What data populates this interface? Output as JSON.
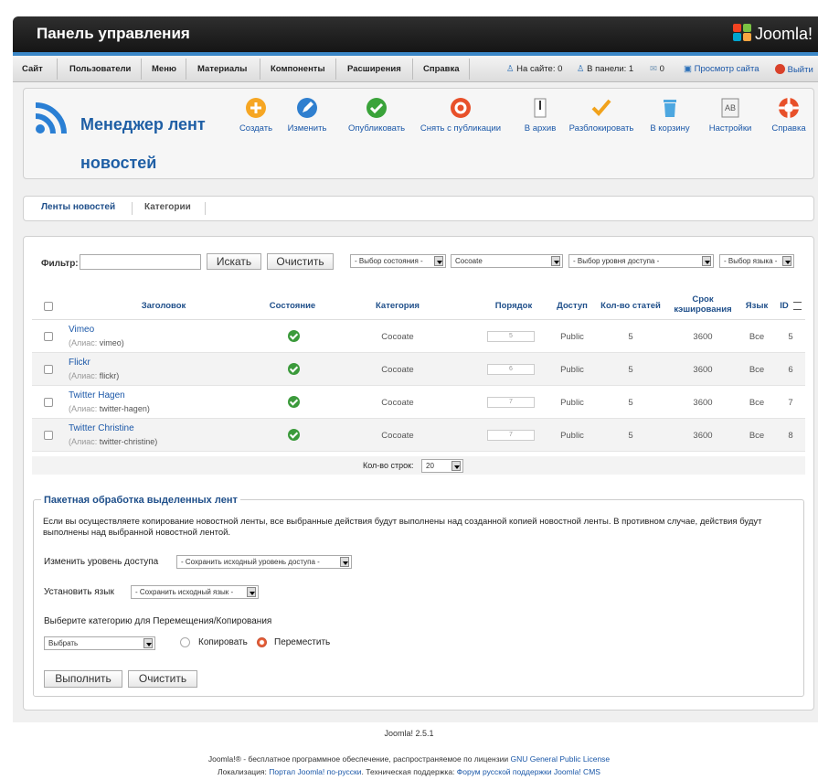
{
  "header": {
    "title": "Панель управления",
    "brand": "Joomla!"
  },
  "menu": {
    "items": [
      "Сайт",
      "Пользователи",
      "Меню",
      "Материалы",
      "Компоненты",
      "Расширения",
      "Справка"
    ],
    "status": {
      "site": "На сайте: 0",
      "panel": "В панели: 1",
      "messages": "0",
      "preview": "Просмотр сайта",
      "logout": "Выйти"
    }
  },
  "toolbar": {
    "title": "Менеджер лент новостей",
    "buttons": [
      "Создать",
      "Изменить",
      "Опубликовать",
      "Снять с публикации",
      "В архив",
      "Разблокировать",
      "В корзину",
      "Настройки",
      "Справка"
    ]
  },
  "tabs": [
    "Ленты новостей",
    "Категории"
  ],
  "filter": {
    "label": "Фильтр:",
    "value": "",
    "search": "Искать",
    "clear": "Очистить",
    "state": "- Выбор состояния -",
    "category": "Cocoate",
    "access": "- Выбор уровня доступа -",
    "language": "- Выбор языка -"
  },
  "table": {
    "headers": [
      "Заголовок",
      "Состояние",
      "Категория",
      "Порядок",
      "Доступ",
      "Кол-во статей",
      "Срок кэширования",
      "Язык",
      "ID"
    ],
    "alias_prefix": "(Алиас: ",
    "rows": [
      {
        "title": "Vimeo",
        "alias": "vimeo)",
        "category": "Cocoate",
        "order": "5",
        "access": "Public",
        "articles": "5",
        "cache": "3600",
        "lang": "Все",
        "id": "5"
      },
      {
        "title": "Flickr",
        "alias": "flickr)",
        "category": "Cocoate",
        "order": "6",
        "access": "Public",
        "articles": "5",
        "cache": "3600",
        "lang": "Все",
        "id": "6"
      },
      {
        "title": "Twitter Hagen",
        "alias": "twitter-hagen)",
        "category": "Cocoate",
        "order": "7",
        "access": "Public",
        "articles": "5",
        "cache": "3600",
        "lang": "Все",
        "id": "7"
      },
      {
        "title": "Twitter Christine",
        "alias": "twitter-christine)",
        "category": "Cocoate",
        "order": "7",
        "access": "Public",
        "articles": "5",
        "cache": "3600",
        "lang": "Все",
        "id": "8"
      }
    ],
    "rows_label": "Кол-во строк:",
    "rows_value": "20"
  },
  "batch": {
    "legend": "Пакетная обработка выделенных лент",
    "desc": "Если вы осуществляете копирование новостной ленты, все выбранные действия будут выполнены над созданной копией новостной ленты. В противном случае, действия будут выполнены над выбранной новостной лентой.",
    "access_label": "Изменить уровень доступа",
    "access_value": "- Сохранить исходный уровень доступа -",
    "lang_label": "Установить язык",
    "lang_value": "- Сохранить исходный язык -",
    "cat_label": "Выберите категорию для Перемещения/Копирования",
    "cat_value": "Выбрать",
    "copy": "Копировать",
    "move": "Переместить",
    "run": "Выполнить",
    "clear": "Очистить"
  },
  "footer": {
    "version": "Joomla! 2.5.1",
    "l1a": "Joomla!® - бесплатное программное обеспечение, распространяемое по лицензии",
    "l1b": "GNU General Public License",
    "l2a": "Локализация:",
    "l2b": "Портал Joomla! по-русски",
    "l2c": ". Техническая поддержка:",
    "l2d": "Форум русской поддержки Joomla! CMS"
  }
}
